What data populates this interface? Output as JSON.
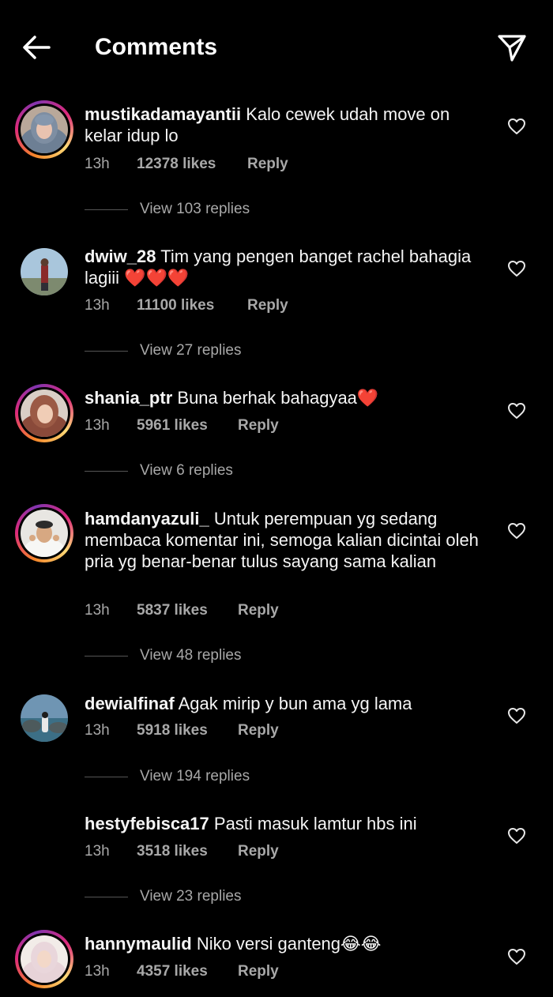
{
  "header": {
    "title": "Comments"
  },
  "comments": [
    {
      "username": "mustikadamayantii",
      "text": "Kalo cewek udah move on kelar idup lo",
      "time": "13h",
      "likes": "12378 likes",
      "reply": "Reply",
      "view_replies": "View 103 replies"
    },
    {
      "username": "dwiw_28",
      "text": "Tim yang pengen banget rachel bahagia lagiii ❤️❤️❤️",
      "time": "13h",
      "likes": "11100 likes",
      "reply": "Reply",
      "view_replies": "View 27 replies"
    },
    {
      "username": "shania_ptr",
      "text": "Buna berhak bahagyaa❤️",
      "time": "13h",
      "likes": "5961 likes",
      "reply": "Reply",
      "view_replies": "View 6 replies"
    },
    {
      "username": "hamdanyazuli_",
      "text": "Untuk perempuan yg sedang membaca komentar ini, semoga kalian dicintai oleh pria yg benar-benar tulus sayang sama kalian",
      "time": "13h",
      "likes": "5837 likes",
      "reply": "Reply",
      "view_replies": "View 48 replies"
    },
    {
      "username": "dewialfinaf",
      "text": "Agak mirip y bun ama yg lama",
      "time": "13h",
      "likes": "5918 likes",
      "reply": "Reply",
      "view_replies": "View 194 replies"
    },
    {
      "username": "hestyfebisca17",
      "text": "Pasti masuk lamtur hbs ini",
      "time": "13h",
      "likes": "3518 likes",
      "reply": "Reply",
      "view_replies": "View 23 replies"
    },
    {
      "username": "hannymaulid",
      "text": "Niko versi ganteng😂😂",
      "time": "13h",
      "likes": "4357 likes",
      "reply": "Reply"
    }
  ],
  "icons": {
    "back": "back-arrow-icon",
    "share": "send-icon",
    "like": "heart-outline-icon"
  },
  "colors": {
    "background": "#000000",
    "text": "#f5f5f5",
    "secondary_text": "#a8a8a8",
    "story_ring": "#dd2a7b"
  }
}
